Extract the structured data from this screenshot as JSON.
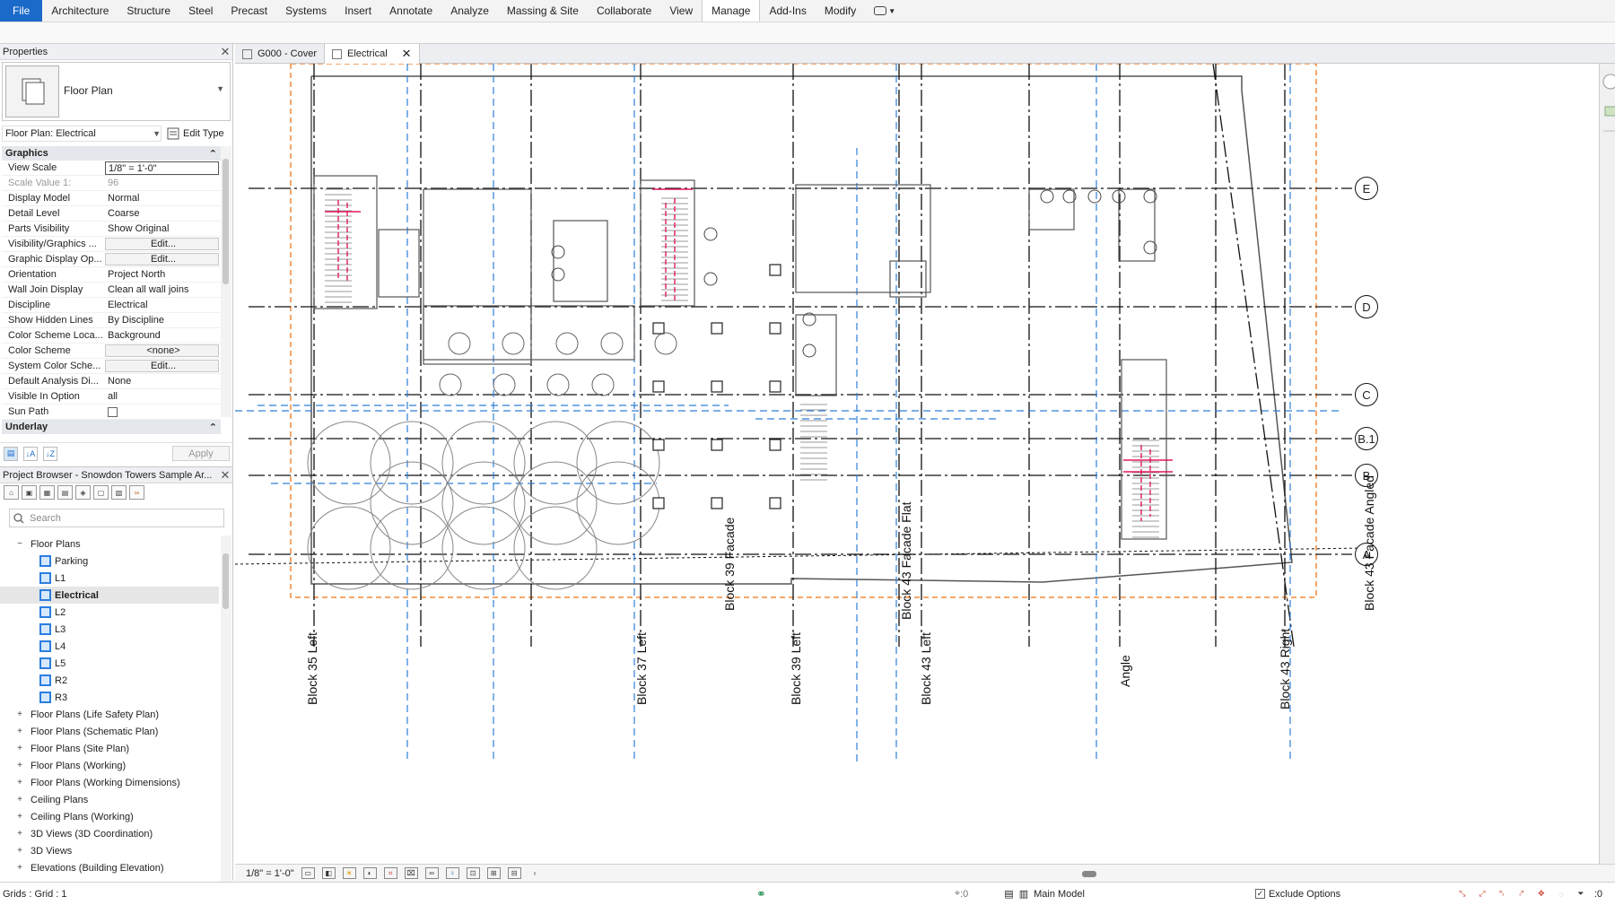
{
  "ribbon": {
    "tabs": [
      "File",
      "Architecture",
      "Structure",
      "Steel",
      "Precast",
      "Systems",
      "Insert",
      "Annotate",
      "Analyze",
      "Massing & Site",
      "Collaborate",
      "View",
      "Manage",
      "Add-Ins",
      "Modify"
    ],
    "active_tab": "Manage",
    "extra_icon": "context-dropdown-icon"
  },
  "properties": {
    "title": "Properties",
    "type_name": "Floor Plan",
    "instance_selector": "Floor Plan: Electrical",
    "edit_type_label": "Edit Type",
    "sections": {
      "graphics": "Graphics",
      "underlay": "Underlay"
    },
    "rows": [
      {
        "key": "View Scale",
        "value": "1/8\" = 1'-0\"",
        "kind": "input"
      },
      {
        "key": "Scale Value    1:",
        "value": "96",
        "kind": "dim"
      },
      {
        "key": "Display Model",
        "value": "Normal",
        "kind": "text"
      },
      {
        "key": "Detail Level",
        "value": "Coarse",
        "kind": "text"
      },
      {
        "key": "Parts Visibility",
        "value": "Show Original",
        "kind": "text"
      },
      {
        "key": "Visibility/Graphics ...",
        "value": "Edit...",
        "kind": "button"
      },
      {
        "key": "Graphic Display Op...",
        "value": "Edit...",
        "kind": "button"
      },
      {
        "key": "Orientation",
        "value": "Project North",
        "kind": "text"
      },
      {
        "key": "Wall Join Display",
        "value": "Clean all wall joins",
        "kind": "text"
      },
      {
        "key": "Discipline",
        "value": "Electrical",
        "kind": "text"
      },
      {
        "key": "Show Hidden Lines",
        "value": "By Discipline",
        "kind": "text"
      },
      {
        "key": "Color Scheme Loca...",
        "value": "Background",
        "kind": "text"
      },
      {
        "key": "Color Scheme",
        "value": "<none>",
        "kind": "button"
      },
      {
        "key": "System Color Sche...",
        "value": "Edit...",
        "kind": "button"
      },
      {
        "key": "Default Analysis Di...",
        "value": "None",
        "kind": "text"
      },
      {
        "key": "Visible In Option",
        "value": "all",
        "kind": "text"
      },
      {
        "key": "Sun Path",
        "value": "",
        "kind": "checkbox"
      }
    ],
    "apply_label": "Apply"
  },
  "browser": {
    "title": "Project Browser - Snowdon Towers Sample Ar...",
    "search_placeholder": "Search",
    "tree": [
      {
        "label": "Floor Plans",
        "level": 1,
        "expander": "−",
        "view": false,
        "selected": false
      },
      {
        "label": "Parking",
        "level": 2,
        "expander": "",
        "view": true,
        "selected": false
      },
      {
        "label": "L1",
        "level": 2,
        "expander": "",
        "view": true,
        "selected": false
      },
      {
        "label": "Electrical",
        "level": 2,
        "expander": "",
        "view": true,
        "selected": true
      },
      {
        "label": "L2",
        "level": 2,
        "expander": "",
        "view": true,
        "selected": false
      },
      {
        "label": "L3",
        "level": 2,
        "expander": "",
        "view": true,
        "selected": false
      },
      {
        "label": "L4",
        "level": 2,
        "expander": "",
        "view": true,
        "selected": false
      },
      {
        "label": "L5",
        "level": 2,
        "expander": "",
        "view": true,
        "selected": false
      },
      {
        "label": "R2",
        "level": 2,
        "expander": "",
        "view": true,
        "selected": false
      },
      {
        "label": "R3",
        "level": 2,
        "expander": "",
        "view": true,
        "selected": false
      },
      {
        "label": "Floor Plans (Life Safety Plan)",
        "level": 1,
        "expander": "+",
        "view": false,
        "selected": false
      },
      {
        "label": "Floor Plans (Schematic Plan)",
        "level": 1,
        "expander": "+",
        "view": false,
        "selected": false
      },
      {
        "label": "Floor Plans (Site Plan)",
        "level": 1,
        "expander": "+",
        "view": false,
        "selected": false
      },
      {
        "label": "Floor Plans (Working)",
        "level": 1,
        "expander": "+",
        "view": false,
        "selected": false
      },
      {
        "label": "Floor Plans (Working Dimensions)",
        "level": 1,
        "expander": "+",
        "view": false,
        "selected": false
      },
      {
        "label": "Ceiling Plans",
        "level": 1,
        "expander": "+",
        "view": false,
        "selected": false
      },
      {
        "label": "Ceiling Plans (Working)",
        "level": 1,
        "expander": "+",
        "view": false,
        "selected": false
      },
      {
        "label": "3D Views (3D Coordination)",
        "level": 1,
        "expander": "+",
        "view": false,
        "selected": false
      },
      {
        "label": "3D Views",
        "level": 1,
        "expander": "+",
        "view": false,
        "selected": false
      },
      {
        "label": "Elevations (Building Elevation)",
        "level": 1,
        "expander": "+",
        "view": false,
        "selected": false
      }
    ]
  },
  "view_tabs": [
    {
      "label": "G000 - Cover",
      "active": false
    },
    {
      "label": "Electrical",
      "active": true
    }
  ],
  "drawing": {
    "horizontal_grids": [
      "E",
      "D",
      "C",
      "B.1",
      "B",
      "A"
    ],
    "vertical_grid_labels": [
      "Block 35 Left",
      "Block 37 Left",
      "Block 39 Facade",
      "Block 39 Left",
      "Block 43 Facade Flat",
      "Block 43 Left",
      "Angle",
      "Block 43 Right",
      "Block 43 Facade Angled"
    ],
    "colors": {
      "crop_region": "#f08a3c",
      "ceiling_lines": "#2f7fd6",
      "electrical_red": "#e0195c",
      "grid_lines": "#111111",
      "walls": "#555555"
    }
  },
  "view_bar": {
    "scale": "1/8\" = 1'-0\""
  },
  "status_bar": {
    "selection": "Grids : Grid : 1",
    "workset_count": ":0",
    "model": "Main Model",
    "exclude_options": "Exclude Options",
    "filter_count": ":0"
  }
}
